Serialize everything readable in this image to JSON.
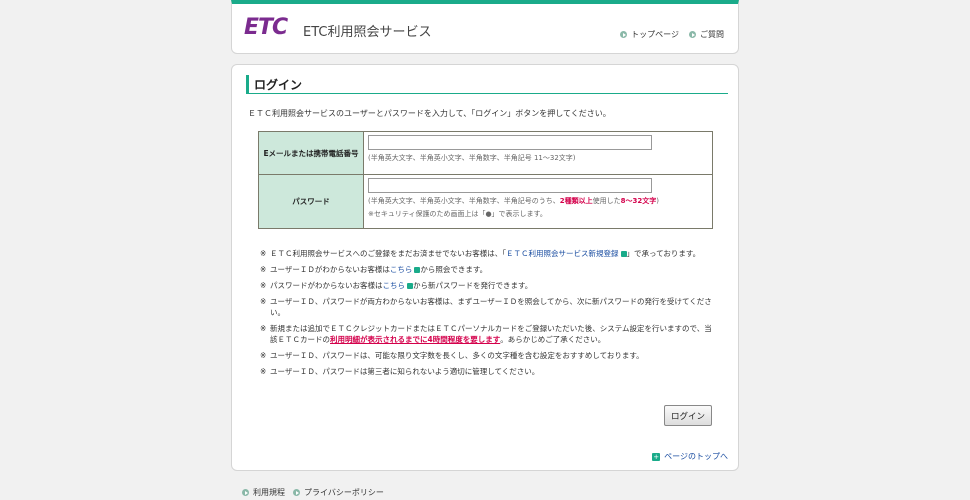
{
  "header": {
    "logo_text": "ETC",
    "app_title": "ETC利用照会サービス",
    "links": [
      {
        "label": "トップページ",
        "icon": "arrow-right-icon"
      },
      {
        "label": "ご質問",
        "icon": "arrow-right-icon"
      }
    ]
  },
  "login": {
    "title": "ログイン",
    "intro": "ＥＴＣ利用照会サービスのユーザーとパスワードを入力して、「ログイン」ボタンを押してください。",
    "user_label": "Eメールまたは携帯電話番号",
    "user_value": "",
    "user_hint": "(半角英大文字、半角英小文字、半角数字、半角記号 11～32文字)",
    "password_label": "パスワード",
    "password_value": "",
    "pw_hint_a": "(半角英大文字、半角英小文字、半角数字、半角記号のうち、",
    "pw_hint_b": "2種類以上",
    "pw_hint_c": "使用した",
    "pw_hint_d": "8～32文字",
    "pw_hint_e": ")",
    "pw_hint_line2": "※セキュリティ保護のため画面上は「●」で表示します。",
    "button_label": "ログイン"
  },
  "notes": {
    "mark": "※",
    "n1_a": "ＥＴＣ利用照会サービスへのご登録をまだお済ませでないお客様は、「",
    "n1_link": "ＥＴＣ利用照会サービス新規登録",
    "n1_b": "」で承っております。",
    "n2_a": "ユーザーＩＤがわからないお客様は",
    "n2_link": "こちら",
    "n2_b": "から照会できます。",
    "n3_a": "パスワードがわからないお客様は",
    "n3_link": "こちら",
    "n3_b": "から新パスワードを発行できます。",
    "n4": "ユーザーＩＤ、パスワードが両方わからないお客様は、まずユーザーＩＤを照会してから、次に新パスワードの発行を受けてください。",
    "n5_a": "新規または追加でＥＴＣクレジットカードまたはＥＴＣパーソナルカードをご登録いただいた後、システム設定を行いますので、当該ＥＴＣカードの",
    "n5_red": "利用明細が表示されるまでに4時間程度を要します",
    "n5_b": "。あらかじめご了承ください。",
    "n6": "ユーザーＩＤ、パスワードは、可能な限り文字数を長くし、多くの文字種を含む設定をおすすめしております。",
    "n7": "ユーザーＩＤ、パスワードは第三者に知られないよう適切に管理してください。"
  },
  "page_top": "ページのトップへ",
  "footer": [
    {
      "label": "利用規程",
      "icon": "arrow-right-icon"
    },
    {
      "label": "プライバシーポリシー",
      "icon": "arrow-right-icon"
    }
  ],
  "colors": {
    "brand_purple": "#7b2b8f",
    "accent_green": "#1aab8a",
    "label_bg": "#cde8db",
    "warning_red": "#d4004b",
    "link_blue": "#1a4da1"
  }
}
